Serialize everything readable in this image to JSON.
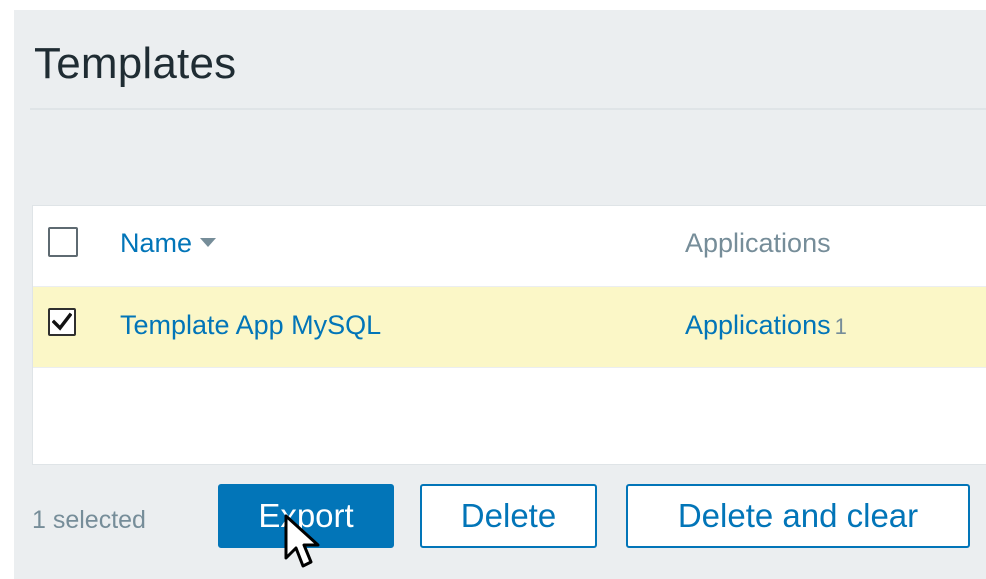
{
  "page": {
    "title": "Templates"
  },
  "table": {
    "columns": {
      "name": "Name",
      "applications": "Applications"
    },
    "sort": {
      "column": "name",
      "direction": "desc"
    },
    "rows": [
      {
        "checked": true,
        "name": "Template App MySQL",
        "applications_link": "Applications",
        "applications_count": "1"
      }
    ]
  },
  "footer": {
    "selected_text": "1 selected",
    "export_label": "Export",
    "delete_label": "Delete",
    "delete_clear_label": "Delete and clear"
  },
  "colors": {
    "accent": "#0275b8",
    "selected_row": "#fbf7c7",
    "page_bg": "#ebeef0",
    "muted_text": "#768d99"
  },
  "icons": {
    "sort": "sort-down-arrow-icon",
    "checkbox_checked": "checkmark-icon",
    "cursor": "mouse-pointer-icon"
  }
}
